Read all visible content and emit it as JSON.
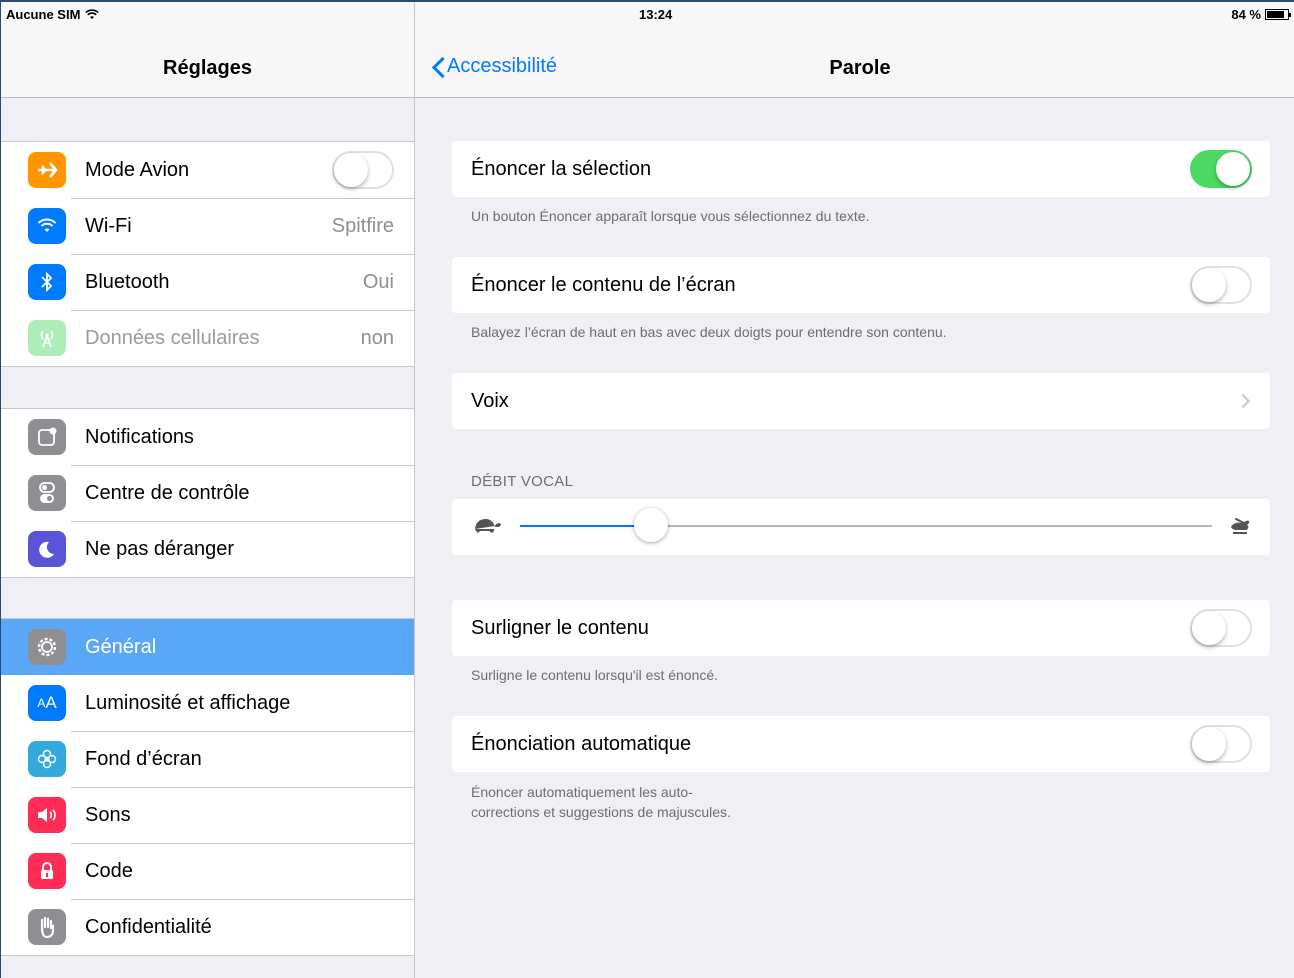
{
  "status_bar": {
    "carrier": "Aucune SIM",
    "time": "13:24",
    "battery": "84 %",
    "battery_level": 0.84
  },
  "left": {
    "title": "Réglages",
    "groups": [
      {
        "items": [
          {
            "label": "Mode Avion",
            "icon": "airplane-icon",
            "color": "#ff9500",
            "control": "switch",
            "on": false
          },
          {
            "label": "Wi-Fi",
            "icon": "wifi-icon",
            "color": "#007aff",
            "value": "Spitfire"
          },
          {
            "label": "Bluetooth",
            "icon": "bluetooth-icon",
            "color": "#007aff",
            "value": "Oui"
          },
          {
            "label": "Données cellulaires",
            "icon": "cellular-antenna-icon",
            "color": "#4cd964",
            "value": "non",
            "disabled": true
          }
        ]
      },
      {
        "items": [
          {
            "label": "Notifications",
            "icon": "notifications-icon",
            "color": "#8e8e93"
          },
          {
            "label": "Centre de contrôle",
            "icon": "control-center-icon",
            "color": "#8e8e93"
          },
          {
            "label": "Ne pas déranger",
            "icon": "moon-icon",
            "color": "#5856d6"
          }
        ]
      },
      {
        "items": [
          {
            "label": "Général",
            "icon": "gear-icon",
            "color": "#8e8e93",
            "selected": true
          },
          {
            "label": "Luminosité et affichage",
            "icon": "text-size-icon",
            "color": "#007aff"
          },
          {
            "label": "Fond d’écran",
            "icon": "wallpaper-flower-icon",
            "color": "#34aadc"
          },
          {
            "label": "Sons",
            "icon": "speaker-icon",
            "color": "#ff2d55"
          },
          {
            "label": "Code",
            "icon": "lock-icon",
            "color": "#ff2d55"
          },
          {
            "label": "Confidentialité",
            "icon": "hand-icon",
            "color": "#8e8e93"
          }
        ]
      }
    ]
  },
  "right": {
    "back_label": "Accessibilité",
    "title": "Parole",
    "speak_selection": {
      "label": "Énoncer la sélection",
      "on": true,
      "footnote": "Un bouton Énoncer apparaît lorsque vous sélectionnez du texte."
    },
    "speak_screen": {
      "label": "Énoncer le contenu de l’écran",
      "on": false,
      "footnote": "Balayez l’écran de haut en bas avec deux doigts pour entendre son contenu."
    },
    "voices": {
      "label": "Voix"
    },
    "speaking_rate": {
      "header": "DÉBIT VOCAL",
      "value": 0.19,
      "slow_icon": "turtle-icon",
      "fast_icon": "hare-icon"
    },
    "highlight": {
      "label": "Surligner le contenu",
      "on": false,
      "footnote": "Surligne le contenu lorsqu'il est énoncé."
    },
    "auto_speak": {
      "label": "Énonciation automatique",
      "on": false,
      "footnote_line1": "Énoncer automatiquement les auto-",
      "footnote_line2": "corrections et suggestions de majuscules."
    }
  },
  "colors": {
    "accent": "#007aff",
    "switch_on": "#4cd964",
    "selection": "#5ba7f7"
  }
}
